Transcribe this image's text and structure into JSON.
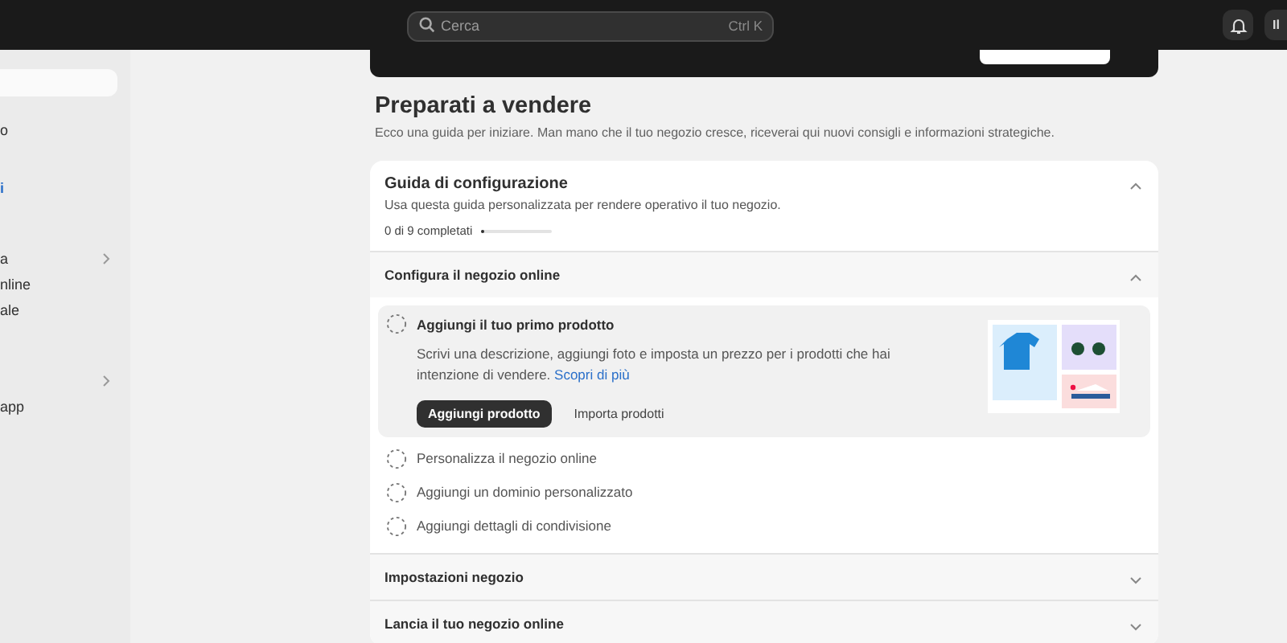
{
  "topbar": {
    "search": {
      "placeholder": "Cerca",
      "shortcut": "Ctrl K"
    },
    "store_button": "Il"
  },
  "sidebar": {
    "items": [
      {
        "label": "o",
        "selected": false,
        "chevron": false
      },
      {
        "label": "i",
        "selected": true,
        "chevron": false
      },
      {
        "label": "a",
        "selected": false,
        "chevron": true
      },
      {
        "label": "nline",
        "selected": false,
        "chevron": false
      },
      {
        "label": "ale",
        "selected": false,
        "chevron": false
      },
      {
        "chevron": true
      },
      {
        "label": "app",
        "selected": false,
        "chevron": false
      }
    ]
  },
  "page": {
    "title": "Preparati a vendere",
    "subtitle": "Ecco una guida per iniziare. Man mano che il tuo negozio cresce, riceverai qui nuovi consigli e informazioni strategiche."
  },
  "guide": {
    "title": "Guida di configurazione",
    "description": "Usa questa guida personalizzata per rendere operativo il tuo negozio.",
    "progress_text": "0 di 9 completati",
    "level": 0.05,
    "expanded": true,
    "sections": [
      {
        "title": "Configura il negozio online",
        "expanded": true,
        "tasks": [
          {
            "title": "Aggiungi il tuo primo prodotto",
            "expanded": true,
            "done": false,
            "description": "Scrivi una descrizione, aggiungi foto e imposta un prezzo per i prodotti che hai intenzione di vendere.",
            "link": "Scopri di più",
            "primary_button": "Aggiungi prodotto",
            "secondary_button": "Importa prodotti"
          },
          {
            "title": "Personalizza il negozio online",
            "expanded": false,
            "done": false
          },
          {
            "title": "Aggiungi un dominio personalizzato",
            "expanded": false,
            "done": false
          },
          {
            "title": "Aggiungi dettagli di condivisione",
            "expanded": false,
            "done": false
          }
        ]
      },
      {
        "title": "Impostazioni negozio",
        "expanded": false
      },
      {
        "title": "Lancia il tuo negozio online",
        "expanded": false
      }
    ]
  }
}
